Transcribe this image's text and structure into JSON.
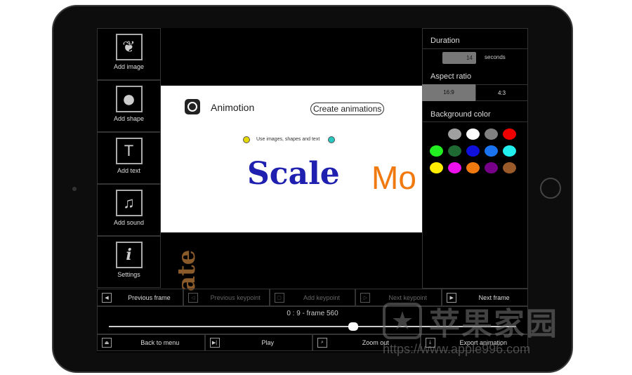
{
  "toolbar": {
    "items": [
      {
        "label": "Add image",
        "icon": "leaf-icon"
      },
      {
        "label": "Add shape",
        "icon": "circle-icon"
      },
      {
        "label": "Add text",
        "icon": "text-icon"
      },
      {
        "label": "Add sound",
        "icon": "music-note-icon"
      },
      {
        "label": "Settings",
        "icon": "info-icon"
      }
    ]
  },
  "canvas": {
    "app_name": "Animotion",
    "button": "Create animations",
    "tagline": "Use images, shapes and text",
    "big_text": "Scale",
    "cut_text": "Mo",
    "rotated_text": "ate",
    "dot_colors": [
      "#e5d800",
      "#28c8c0"
    ]
  },
  "settings": {
    "duration_label": "Duration",
    "duration_value": "14",
    "duration_unit": "seconds",
    "aspect_label": "Aspect ratio",
    "aspect_options": [
      "16:9",
      "4:3"
    ],
    "aspect_selected": "16:9",
    "bg_label": "Background color",
    "colors": [
      "#a0a0a0",
      "#ffffff",
      "#808080",
      "#ee0000",
      "#22ee22",
      "#1e6a32",
      "#1010dd",
      "#1a73f0",
      "#22eeee",
      "#ffee00",
      "#ee11ee",
      "#f07a10",
      "#770088",
      "#9a5a2a"
    ]
  },
  "frame_controls": [
    "Previous frame",
    "Previous keypoint",
    "Add keypoint",
    "Next keypoint",
    "Next frame"
  ],
  "timeline": {
    "label": "0 : 9 - frame 560",
    "progress": 0.6
  },
  "bottom_bar": [
    "Back to menu",
    "Play",
    "Zoom out",
    "Export animation"
  ],
  "watermark": {
    "text": "苹果家园",
    "url": "https://www.apple996.com"
  }
}
